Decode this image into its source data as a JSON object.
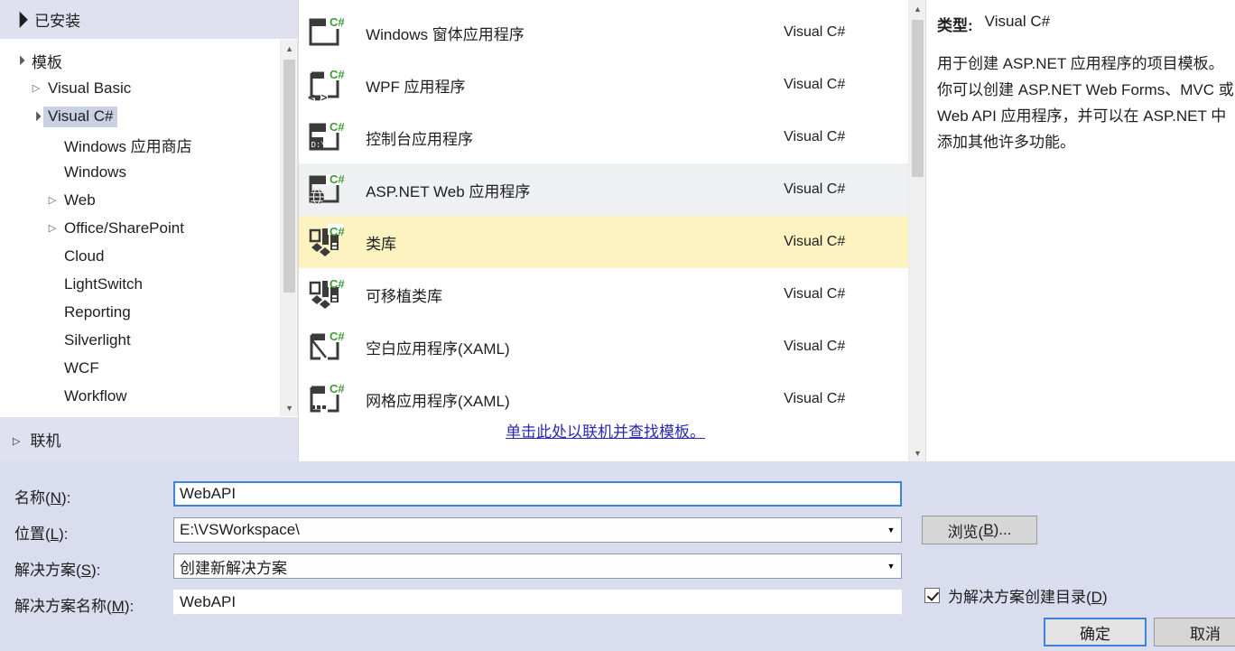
{
  "sidebar": {
    "installed_header": "已安装",
    "online_header": "联机",
    "tree": [
      {
        "label": "模板",
        "indent": 0,
        "expander": "down",
        "selected": false
      },
      {
        "label": "Visual Basic",
        "indent": 1,
        "expander": "right",
        "selected": false
      },
      {
        "label": "Visual C#",
        "indent": 1,
        "expander": "down",
        "selected": true
      },
      {
        "label": "Windows 应用商店",
        "indent": 2,
        "expander": "none",
        "selected": false
      },
      {
        "label": "Windows",
        "indent": 2,
        "expander": "none",
        "selected": false
      },
      {
        "label": "Web",
        "indent": 2,
        "expander": "right",
        "selected": false
      },
      {
        "label": "Office/SharePoint",
        "indent": 2,
        "expander": "right",
        "selected": false
      },
      {
        "label": "Cloud",
        "indent": 2,
        "expander": "none",
        "selected": false
      },
      {
        "label": "LightSwitch",
        "indent": 2,
        "expander": "none",
        "selected": false
      },
      {
        "label": "Reporting",
        "indent": 2,
        "expander": "none",
        "selected": false
      },
      {
        "label": "Silverlight",
        "indent": 2,
        "expander": "none",
        "selected": false
      },
      {
        "label": "WCF",
        "indent": 2,
        "expander": "none",
        "selected": false
      },
      {
        "label": "Workflow",
        "indent": 2,
        "expander": "none",
        "selected": false
      }
    ]
  },
  "templates": {
    "items": [
      {
        "name": "Windows 窗体应用程序",
        "lang": "Visual C#",
        "icon": "winforms-icon",
        "state": "normal"
      },
      {
        "name": "WPF 应用程序",
        "lang": "Visual C#",
        "icon": "wpf-icon",
        "state": "normal"
      },
      {
        "name": "控制台应用程序",
        "lang": "Visual C#",
        "icon": "console-icon",
        "state": "normal"
      },
      {
        "name": "ASP.NET Web 应用程序",
        "lang": "Visual C#",
        "icon": "aspnet-web-icon",
        "state": "hover"
      },
      {
        "name": "类库",
        "lang": "Visual C#",
        "icon": "classlib-icon",
        "state": "selected"
      },
      {
        "name": "可移植类库",
        "lang": "Visual C#",
        "icon": "classlib-icon",
        "state": "normal"
      },
      {
        "name": "空白应用程序(XAML)",
        "lang": "Visual C#",
        "icon": "blankapp-icon",
        "state": "normal"
      },
      {
        "name": "网格应用程序(XAML)",
        "lang": "Visual C#",
        "icon": "gridapp-icon",
        "state": "normal"
      }
    ],
    "online_link": "单击此处以联机并查找模板。"
  },
  "description": {
    "type_label": "类型:",
    "type_value": "Visual C#",
    "body": "用于创建 ASP.NET 应用程序的项目模板。你可以创建 ASP.NET Web Forms、MVC 或 Web API 应用程序，并可以在 ASP.NET 中添加其他许多功能。"
  },
  "form": {
    "name_label_pre": "名称(",
    "name_label_key": "N",
    "name_label_post": "):",
    "name_value": "WebAPI",
    "location_label_pre": "位置(",
    "location_label_key": "L",
    "location_label_post": "):",
    "location_value": "E:\\VSWorkspace\\",
    "solution_label_pre": "解决方案(",
    "solution_label_key": "S",
    "solution_label_post": "):",
    "solution_value": "创建新解决方案",
    "solname_label_pre": "解决方案名称(",
    "solname_label_key": "M",
    "solname_label_post": "):",
    "solname_value": "WebAPI",
    "browse_pre": "浏览(",
    "browse_key": "B",
    "browse_post": ")...",
    "create_dir_pre": "为解决方案创建目录(",
    "create_dir_key": "D",
    "create_dir_post": ")",
    "create_dir_checked": true,
    "ok_label": "确定",
    "cancel_label": "取消"
  },
  "colors": {
    "selected_row": "#fcf3c0",
    "hover_row": "#eff0f1",
    "dialog_bg": "#d9ddee",
    "header_bg": "#dfe2ee",
    "tree_select": "#c9d0e4",
    "link": "#2a2ab0",
    "focus_border": "#3f83d6",
    "csharp_green": "#3f9b35"
  }
}
